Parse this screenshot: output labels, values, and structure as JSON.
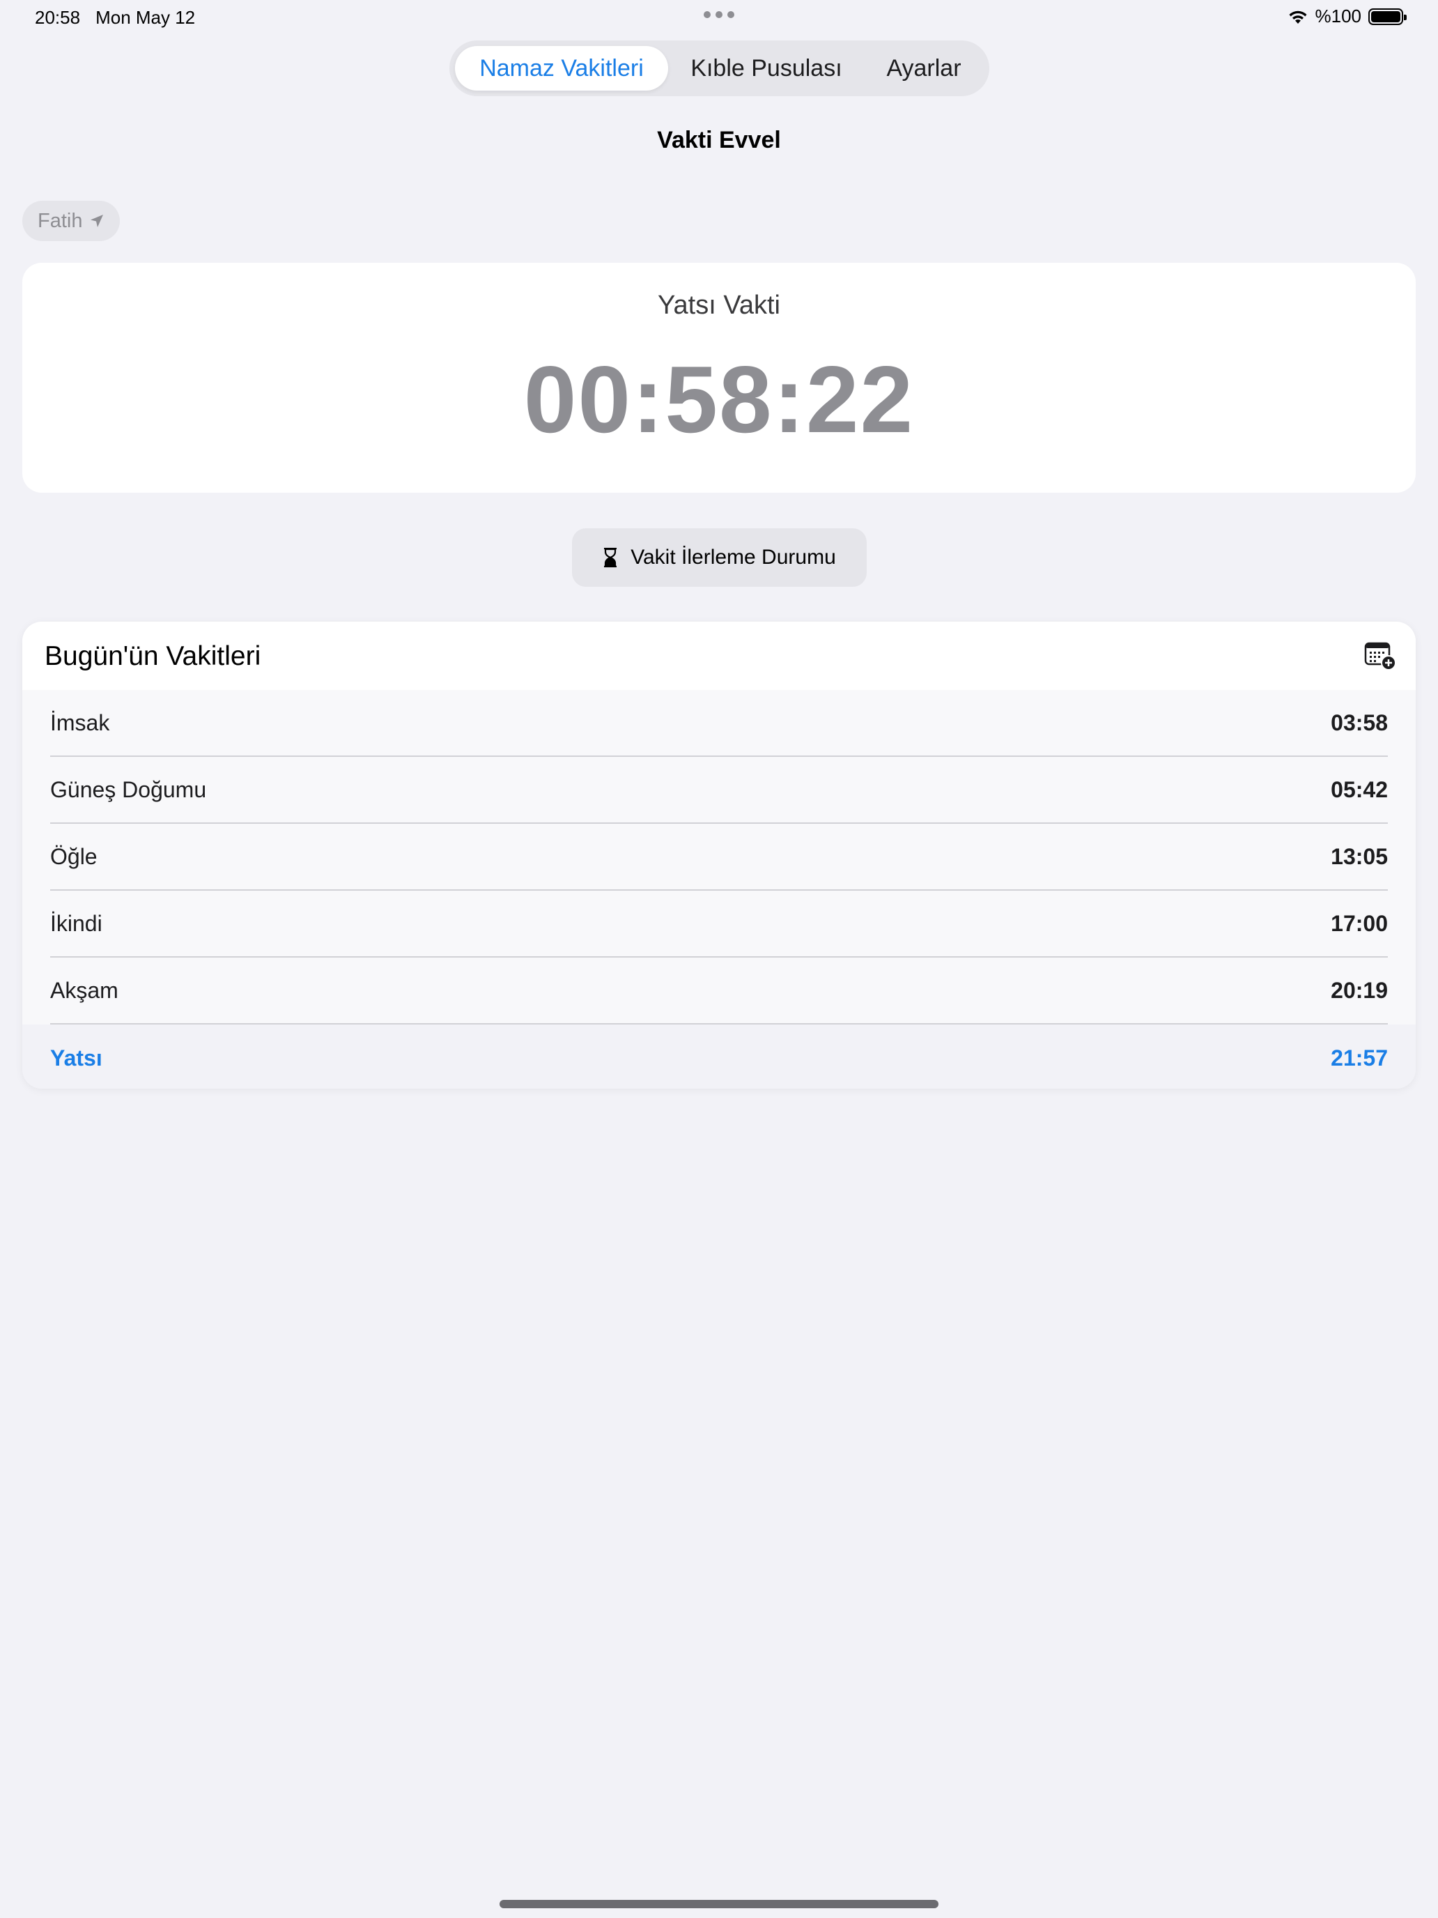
{
  "status_bar": {
    "time": "20:58",
    "date": "Mon May 12",
    "battery": "%100"
  },
  "tabs": [
    {
      "label": "Namaz Vakitleri",
      "active": true
    },
    {
      "label": "Kıble Pusulası",
      "active": false
    },
    {
      "label": "Ayarlar",
      "active": false
    }
  ],
  "header": {
    "title": "Vakti Evvel"
  },
  "location": {
    "name": "Fatih"
  },
  "countdown": {
    "label": "Yatsı Vakti",
    "time": "00:58:22"
  },
  "progress_button": {
    "label": "Vakit İlerleme Durumu"
  },
  "today": {
    "title": "Bugün'ün Vakitleri",
    "rows": [
      {
        "name": "İmsak",
        "time": "03:58"
      },
      {
        "name": "Güneş Doğumu",
        "time": "05:42"
      },
      {
        "name": "Öğle",
        "time": "13:05"
      },
      {
        "name": "İkindi",
        "time": "17:00"
      },
      {
        "name": "Akşam",
        "time": "20:19"
      },
      {
        "name": "Yatsı",
        "time": "21:57"
      }
    ]
  },
  "colors": {
    "accent": "#1a7ee6",
    "muted": "#8e8e93",
    "background": "#f2f2f7"
  }
}
